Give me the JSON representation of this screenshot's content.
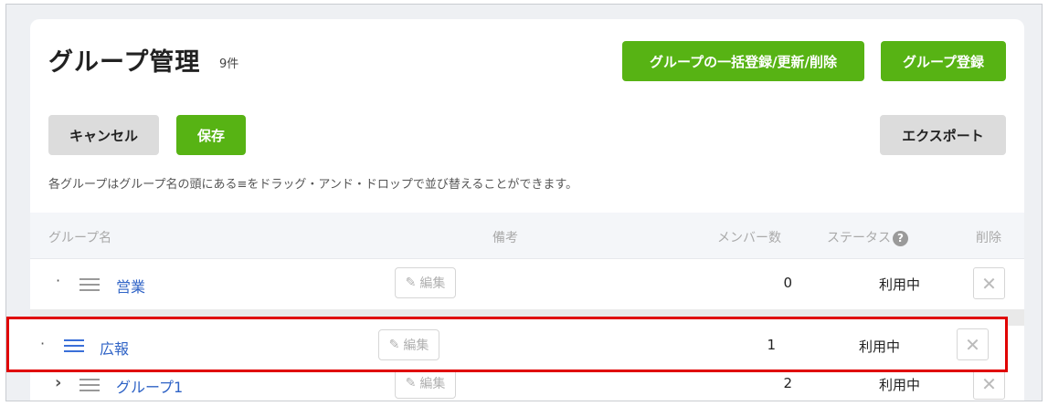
{
  "header": {
    "title": "グループ管理",
    "count": "9件",
    "bulk_button": "グループの一括登録/更新/削除",
    "register_button": "グループ登録"
  },
  "toolbar": {
    "cancel": "キャンセル",
    "save": "保存",
    "export": "エクスポート"
  },
  "hint": "各グループはグループ名の頭にある≡をドラッグ・アンド・ドロップで並び替えることができます。",
  "table": {
    "columns": {
      "name": "グループ名",
      "note": "備考",
      "members": "メンバー数",
      "status": "ステータス",
      "delete": "削除"
    },
    "edit_label": "編集",
    "rows": [
      {
        "name": "営業",
        "members": "0",
        "status": "利用中"
      },
      {
        "name": "グループ1",
        "members": "2",
        "status": "利用中"
      }
    ],
    "dragging_row": {
      "name": "広報",
      "members": "1",
      "status": "利用中"
    }
  },
  "colors": {
    "accent_green": "#57b314",
    "link_blue": "#2f63c6",
    "highlight_red": "#e00000"
  }
}
